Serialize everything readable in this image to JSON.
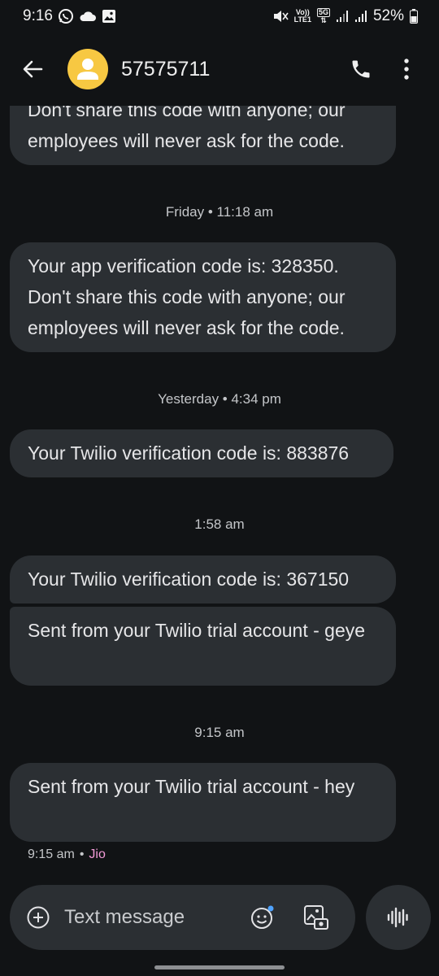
{
  "status_bar": {
    "time": "9:16",
    "volte_label": "Vo))",
    "lte_label": "LTE1",
    "network_label": "5G",
    "battery_percent": "52%"
  },
  "header": {
    "contact": "57575711",
    "icons": [
      "back-arrow-icon",
      "avatar-person-icon",
      "phone-icon",
      "more-vert-icon"
    ]
  },
  "messages": [
    {
      "text": "Don't share this code with anyone; our employees will never ask for the code."
    },
    {
      "text": "Your app verification code is: 328350. Don't share this code with anyone; our employees will never ask for the code."
    },
    {
      "text": "Your Twilio verification code is: 883876"
    },
    {
      "text": "Your Twilio verification code is: 367150"
    },
    {
      "text": "Sent from your Twilio trial account - geye"
    },
    {
      "text": "Sent from your Twilio trial account - hey"
    }
  ],
  "timestamps": {
    "friday": "Friday • 11:18 am",
    "yesterday": "Yesterday • 4:34 pm",
    "t158": "1:58 am",
    "t915": "9:15 am"
  },
  "last_message_meta": {
    "time": "9:15 am",
    "separator": "•",
    "carrier": "Jio"
  },
  "compose": {
    "placeholder": "Text message"
  },
  "colors": {
    "background": "#111315",
    "bubble": "#2b2f33",
    "avatar": "#f7c842",
    "carrier_accent": "#f29bd7",
    "emoji_badge": "#4fa3ff"
  }
}
